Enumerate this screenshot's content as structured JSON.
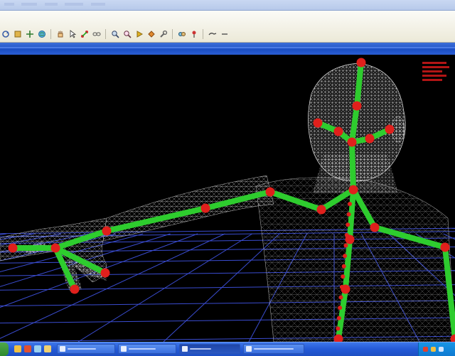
{
  "menubar": {
    "items": []
  },
  "toolbar": {
    "buttons": [
      "rotate-icon",
      "select-icon",
      "move-icon",
      "globe-icon",
      "hand-icon",
      "cursor-icon",
      "joint-icon",
      "chain-icon",
      "zoom-icon",
      "magnify-icon",
      "play-icon",
      "fill-icon",
      "wrench-icon",
      "link-icon",
      "pin-icon",
      "arrow-icon",
      "minus-icon"
    ]
  },
  "viewport": {
    "background": "#000000",
    "mesh_color": "#d8d8d8",
    "floor_grid_color": "#3a4cd0",
    "bone_color": "#2ecc2e",
    "joint_color": "#e0201c",
    "readout_color": "#c51717"
  },
  "taskbar": {
    "color": "#2459d6",
    "tasks": [
      {
        "active": false
      },
      {
        "active": false
      },
      {
        "active": true
      },
      {
        "active": false
      }
    ]
  }
}
